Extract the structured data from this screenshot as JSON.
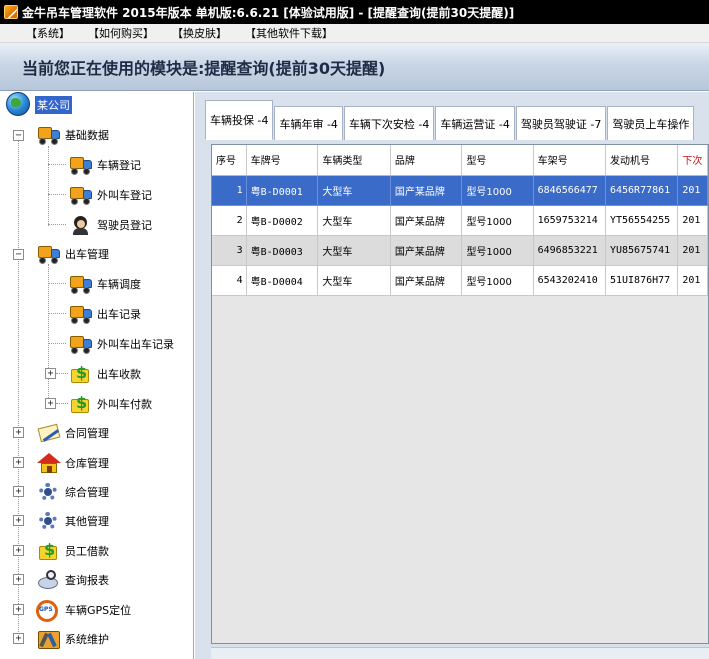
{
  "window": {
    "title": "金牛吊车管理软件 2015年版本 单机版:6.6.21 [体验试用版] - [提醒查询(提前30天提醒)]"
  },
  "menu": [
    "【系统】",
    "【如何购买】",
    "【换皮肤】",
    "【其他软件下载】"
  ],
  "banner": {
    "prefix": "当前您正在使用的模块是:",
    "module": "提醒查询(提前30天提醒)"
  },
  "tree": {
    "root": "某公司",
    "groups": {
      "basic": {
        "label": "基础数据",
        "expander": "−",
        "icon": "truck-icon"
      },
      "basic_vehicle": {
        "label": "车辆登记",
        "icon": "truck-icon"
      },
      "basic_external": {
        "label": "外叫车登记",
        "icon": "truck-icon"
      },
      "basic_driver": {
        "label": "驾驶员登记",
        "icon": "driver-icon"
      },
      "dispatch": {
        "label": "出车管理",
        "expander": "−",
        "icon": "truck-icon"
      },
      "dispatch_schedule": {
        "label": "车辆调度",
        "icon": "truck-icon"
      },
      "dispatch_record": {
        "label": "出车记录",
        "icon": "truck-icon"
      },
      "dispatch_external_record": {
        "label": "外叫车出车记录",
        "icon": "truck-icon"
      },
      "dispatch_income": {
        "label": "出车收款",
        "expander": "+",
        "icon": "money-icon"
      },
      "dispatch_external_pay": {
        "label": "外叫车付款",
        "expander": "+",
        "icon": "money-icon"
      },
      "contract": {
        "label": "合同管理",
        "expander": "+",
        "icon": "contract-icon"
      },
      "warehouse": {
        "label": "仓库管理",
        "expander": "+",
        "icon": "house-icon"
      },
      "general": {
        "label": "综合管理",
        "expander": "+",
        "icon": "gear-icon"
      },
      "other": {
        "label": "其他管理",
        "expander": "+",
        "icon": "gear-icon"
      },
      "loan": {
        "label": "员工借款",
        "expander": "+",
        "icon": "money-icon"
      },
      "reports": {
        "label": "查询报表",
        "expander": "+",
        "icon": "report-icon"
      },
      "gps": {
        "label": "车辆GPS定位",
        "expander": "+",
        "icon": "gps-icon",
        "icon_text": "GPS"
      },
      "maintenance": {
        "label": "系统维护",
        "expander": "+",
        "icon": "maintenance-icon"
      }
    }
  },
  "tabs": [
    {
      "label": "车辆投保 -4"
    },
    {
      "label": "车辆年审 -4"
    },
    {
      "label": "车辆下次安检 -4"
    },
    {
      "label": "车辆运营证 -4"
    },
    {
      "label": "驾驶员驾驶证 -7"
    },
    {
      "label": "驾驶员上车操作"
    }
  ],
  "table": {
    "columns": [
      "序号",
      "车牌号",
      "车辆类型",
      "品牌",
      "型号",
      "车架号",
      "发动机号",
      "下次"
    ],
    "rows": [
      [
        "1",
        "粤B-D0001",
        "大型车",
        "国产某品牌",
        "型号1000",
        "6846566477",
        "6456R77861",
        "201"
      ],
      [
        "2",
        "粤B-D0002",
        "大型车",
        "国产某品牌",
        "型号1000",
        "1659753214",
        "YT56554255",
        "201"
      ],
      [
        "3",
        "粤B-D0003",
        "大型车",
        "国产某品牌",
        "型号1000",
        "6496853221",
        "YU85675741",
        "201"
      ],
      [
        "4",
        "粤B-D0004",
        "大型车",
        "国产某品牌",
        "型号1000",
        "6543202410",
        "51UI876H77",
        "201"
      ]
    ]
  },
  "colors": {
    "selection": "#3a6bc9",
    "due_header": "#d01010",
    "titlebar": "#000000"
  }
}
